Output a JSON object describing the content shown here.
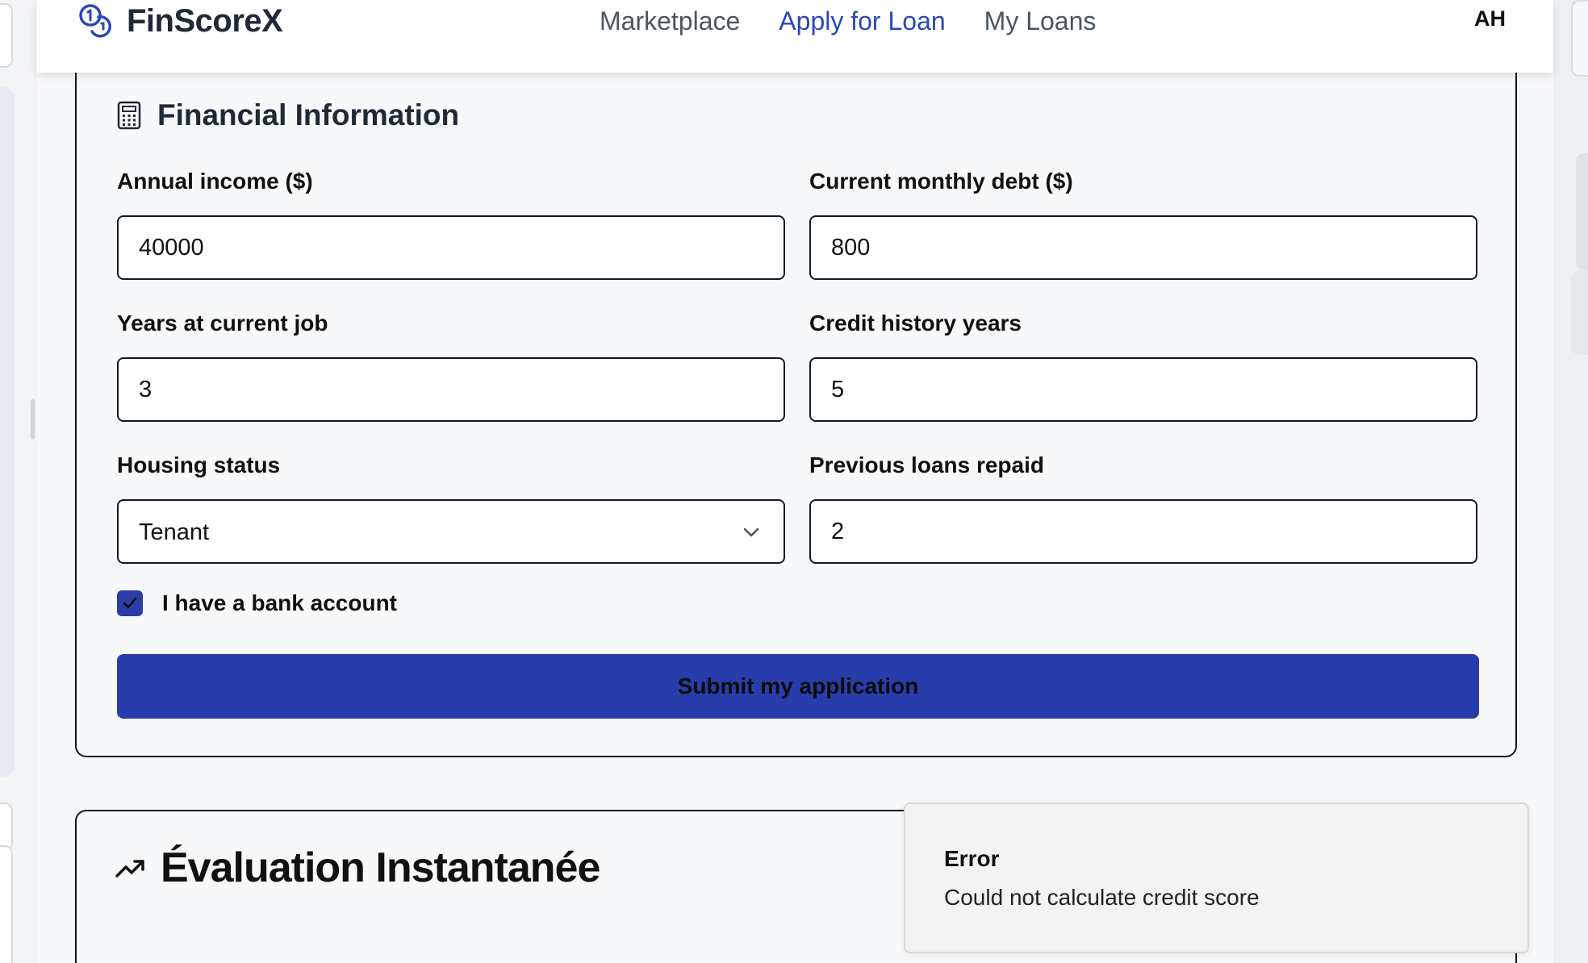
{
  "header": {
    "brand": "FinScoreX",
    "nav": [
      {
        "label": "Marketplace",
        "active": false
      },
      {
        "label": "Apply for Loan",
        "active": true
      },
      {
        "label": "My Loans",
        "active": false
      }
    ],
    "avatar_initials": "AH"
  },
  "financial": {
    "title": "Financial Information",
    "fields": {
      "annual_income": {
        "label": "Annual income ($)",
        "value": "40000"
      },
      "monthly_debt": {
        "label": "Current monthly debt ($)",
        "value": "800"
      },
      "years_job": {
        "label": "Years at current job",
        "value": "3"
      },
      "credit_history": {
        "label": "Credit history years",
        "value": "5"
      },
      "housing": {
        "label": "Housing status",
        "value": "Tenant"
      },
      "loans_repaid": {
        "label": "Previous loans repaid",
        "value": "2"
      }
    },
    "bank_account": {
      "label": "I have a bank account",
      "checked": true
    },
    "submit_label": "Submit my application"
  },
  "evaluation": {
    "title": "Évaluation Instantanée"
  },
  "toast": {
    "title": "Error",
    "message": "Could not calculate credit score"
  },
  "colors": {
    "accent": "#2b48b5",
    "button": "#283dab",
    "checkbox": "#2b3ea5",
    "border": "#111827"
  }
}
